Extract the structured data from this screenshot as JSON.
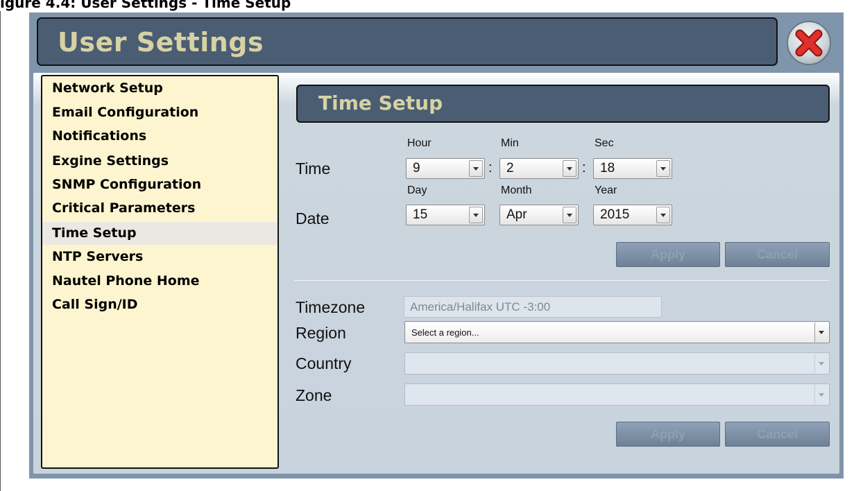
{
  "caption": "igure 4.4: User Settings - Time Setup",
  "window": {
    "title": "User Settings"
  },
  "sidebar": {
    "items": [
      {
        "label": "Network Setup"
      },
      {
        "label": "Email Configuration"
      },
      {
        "label": "Notifications"
      },
      {
        "label": "Exgine Settings"
      },
      {
        "label": "SNMP Configuration"
      },
      {
        "label": "Critical Parameters"
      },
      {
        "label": "Time Setup",
        "active": true
      },
      {
        "label": "NTP Servers"
      },
      {
        "label": "Nautel Phone Home"
      },
      {
        "label": "Call Sign/ID"
      }
    ]
  },
  "time_setup": {
    "title": "Time Setup",
    "time_label": "Time",
    "date_label": "Date",
    "hour": {
      "label": "Hour",
      "value": "9"
    },
    "min": {
      "label": "Min",
      "value": "2"
    },
    "sec": {
      "label": "Sec",
      "value": "18"
    },
    "day": {
      "label": "Day",
      "value": "15"
    },
    "month": {
      "label": "Month",
      "value": "Apr"
    },
    "year": {
      "label": "Year",
      "value": "2015"
    },
    "separator": ":",
    "apply_label": "Apply",
    "cancel_label": "Cancel"
  },
  "timezone": {
    "timezone_label": "Timezone",
    "timezone_value": "America/Halifax UTC -3:00",
    "region_label": "Region",
    "region_value": "Select a region...",
    "country_label": "Country",
    "country_value": "",
    "zone_label": "Zone",
    "zone_value": "",
    "apply_label": "Apply",
    "cancel_label": "Cancel"
  },
  "colors": {
    "title_bar": "#4b5d72",
    "title_text": "#d6d2a4",
    "panel_background": "#7f95ab",
    "sidebar_background": "#fdf5cf",
    "close_icon": "#e0302c"
  }
}
